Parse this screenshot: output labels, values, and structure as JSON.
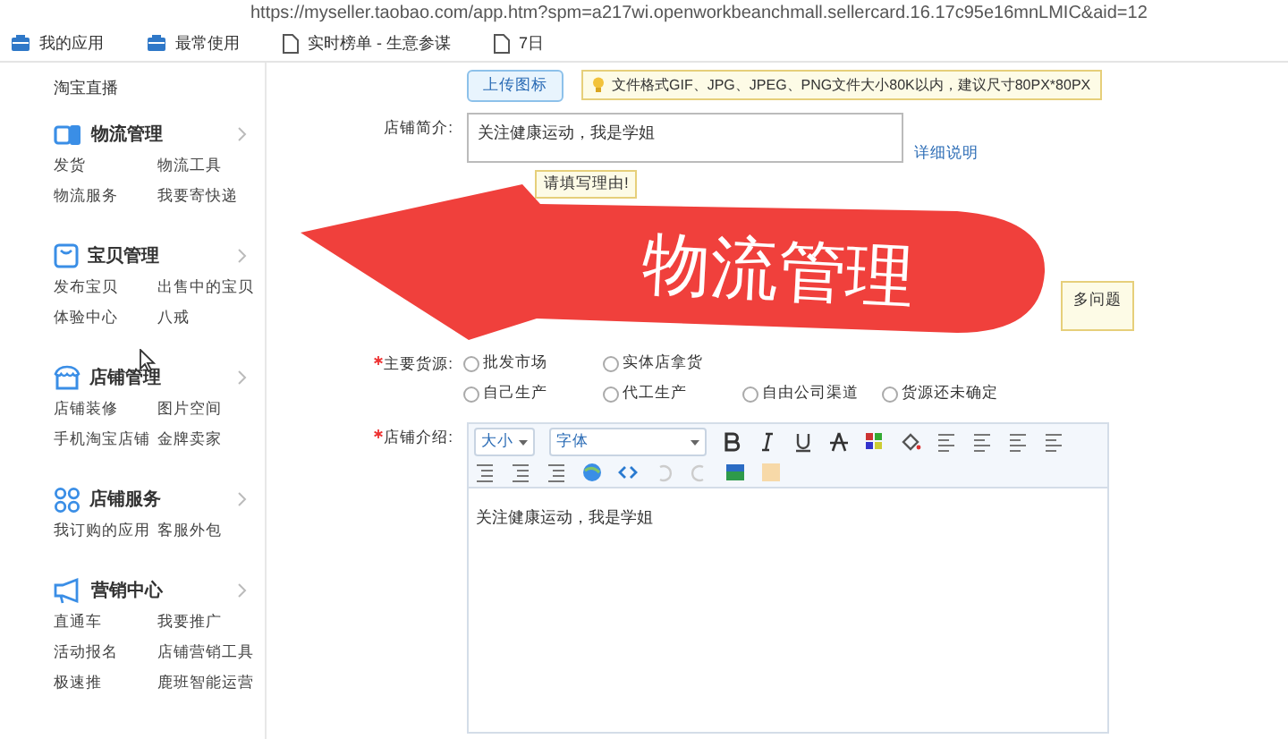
{
  "browser": {
    "url": "https://myseller.taobao.com/app.htm?spm=a217wi.openworkbeanchmall.sellercard.16.17c95e16mnLMIC&aid=12",
    "bookmarks": [
      {
        "label": "我的应用",
        "kind": "app"
      },
      {
        "label": "最常使用",
        "kind": "app"
      },
      {
        "label": "实时榜单 - 生意参谋",
        "kind": "page"
      },
      {
        "label": "7日",
        "kind": "page"
      }
    ]
  },
  "sidebar": {
    "top_link": "淘宝直播",
    "sections": [
      {
        "title": "物流管理",
        "kind": "logistics",
        "links": [
          "发货",
          "物流工具",
          "物流服务",
          "我要寄快递"
        ]
      },
      {
        "title": "宝贝管理",
        "kind": "goods",
        "links": [
          "发布宝贝",
          "出售中的宝贝",
          "体验中心",
          "八戒"
        ]
      },
      {
        "title": "店铺管理",
        "kind": "shop",
        "links": [
          "店铺装修",
          "图片空间",
          "手机淘宝店铺",
          "金牌卖家"
        ]
      },
      {
        "title": "店铺服务",
        "kind": "service",
        "links": [
          "我订购的应用",
          "客服外包"
        ]
      },
      {
        "title": "营销中心",
        "kind": "marketing",
        "links": [
          "直通车",
          "我要推广",
          "活动报名",
          "店铺营销工具",
          "极速推",
          "鹿班智能运营"
        ]
      }
    ]
  },
  "form": {
    "upload_button": "上传图标",
    "upload_hint": "文件格式GIF、JPG、JPEG、PNG文件大小80K以内，建议尺寸80PX*80PX",
    "intro": {
      "label": "店铺简介:",
      "value": "关注健康运动，我是学姐",
      "link": "详细说明"
    },
    "notice": "请填写理由!",
    "side_notice": "多问题",
    "source": {
      "label": "主要货源:",
      "required": true,
      "rows": [
        [
          {
            "label": "批发市场",
            "selected": false
          },
          {
            "label": "实体店拿货",
            "selected": false
          }
        ],
        [
          {
            "label": "自己生产",
            "selected": false
          },
          {
            "label": "代工生产",
            "selected": false
          },
          {
            "label": "自由公司渠道",
            "selected": false
          },
          {
            "label": "货源还未确定",
            "selected": false
          }
        ]
      ]
    },
    "editor": {
      "label": "店铺介绍:",
      "required": true,
      "size_select": "大小",
      "font_select": "字体",
      "content": "关注健康运动，我是学姐"
    }
  },
  "overlay": {
    "label": "物流管理"
  }
}
